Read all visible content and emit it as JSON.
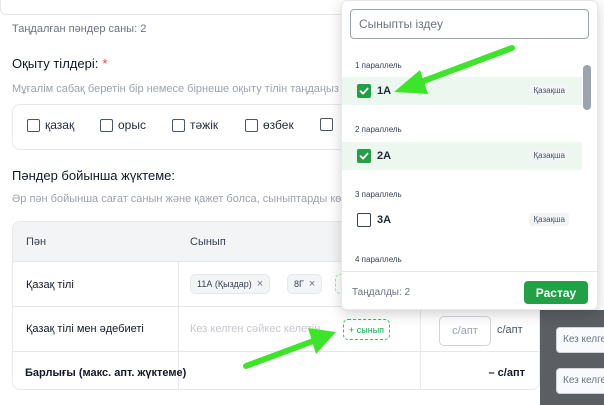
{
  "header": {
    "selected_subjects_count": "Таңдалған пәндер саны: 2"
  },
  "languages": {
    "title": "Оқыту тілдері:",
    "required_mark": "*",
    "hint": "Мұғалім сабақ беретін бір немесе бірнеше оқыту тілін таңдаңыз",
    "options": [
      "қазақ",
      "орыс",
      "тәжік",
      "өзбек"
    ]
  },
  "subject_load": {
    "title": "Пәндер бойынша жүктеме:",
    "hint": "Әр пән бойынша сағат санын және қажет болса, сыныптарды көрсетіңіз",
    "table": {
      "col_subject": "Пән",
      "col_class": "Сынып",
      "rows": [
        {
          "subject": "Қазақ тілі",
          "chips": [
            "11А (Қыздар)",
            "8Г"
          ],
          "chip_remove": "×"
        },
        {
          "subject": "Қазақ тілі мен әдебиеті",
          "match_placeholder": "Кез келген сәйкес келетін",
          "add_class": "+ сынып",
          "week_placeholder": "с/апт",
          "week_unit": "с/апт"
        }
      ],
      "total_label": "Барлығы (макс. апт. жүктеме)",
      "total_value": "– с/апт"
    }
  },
  "background_cells": [
    "Кез келген",
    "Кез келген"
  ],
  "class_dropdown": {
    "search_placeholder": "Сыныпты іздеу",
    "groups": [
      {
        "label": "1 параллель",
        "options": [
          {
            "name": "1А",
            "lang": "Қазақша",
            "checked": true
          }
        ]
      },
      {
        "label": "2 параллель",
        "options": [
          {
            "name": "2А",
            "lang": "Қазақша",
            "checked": true
          }
        ]
      },
      {
        "label": "3 параллель",
        "options": [
          {
            "name": "3А",
            "lang": "Қазақша",
            "checked": false
          }
        ]
      },
      {
        "label": "4 параллель",
        "options": []
      }
    ],
    "selected_count": "Таңдалды: 2",
    "confirm_label": "Растау"
  },
  "colors": {
    "accent_green": "#22a046",
    "selected_row_bg": "#ecf7ef",
    "annotation_arrow": "#3de52a",
    "required_red": "#ef4444"
  },
  "icons": {
    "check": "check-icon",
    "remove": "close-icon",
    "annotation": "annotation-arrow-icon"
  }
}
